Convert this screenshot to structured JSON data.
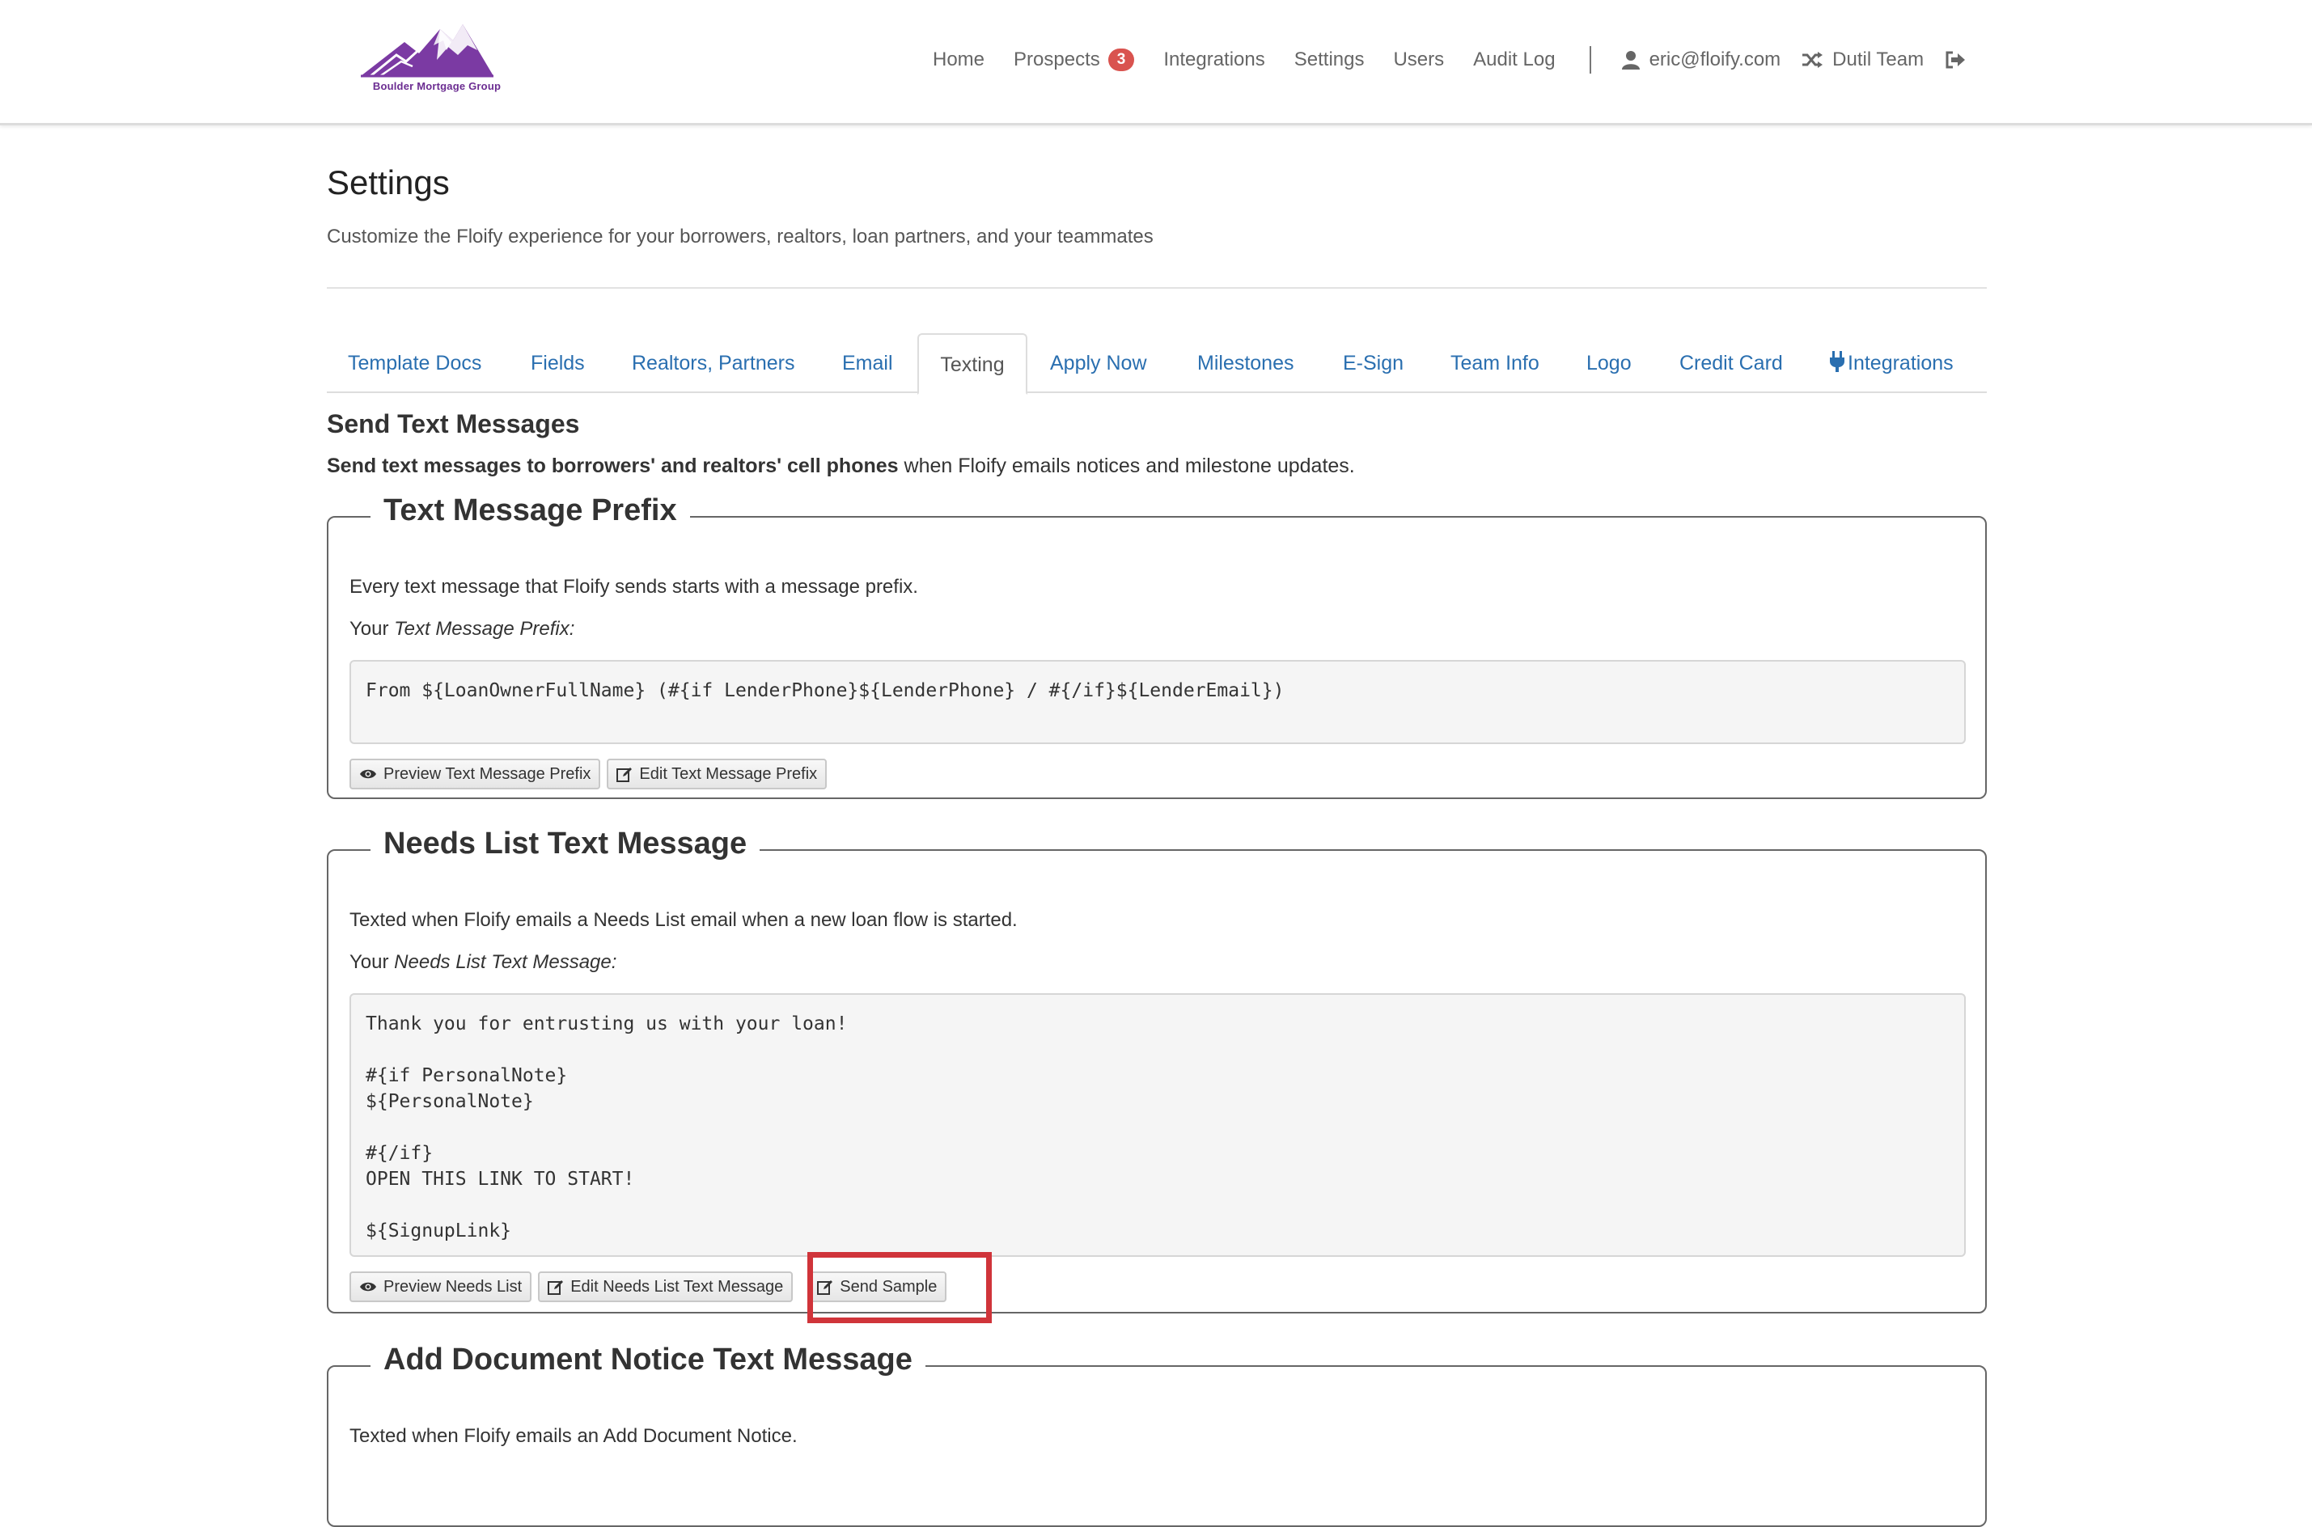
{
  "brand": {
    "logo_text": "Boulder Mortgage Group",
    "color": "#6b2c91"
  },
  "nav": {
    "links": [
      "Home",
      "Prospects",
      "Integrations",
      "Settings",
      "Users",
      "Audit Log"
    ],
    "prospects_badge": "3",
    "user_email": "eric@floify.com",
    "team": "Dutil Team",
    "icons": [
      "user-icon",
      "shuffle-icon",
      "sign-out-icon"
    ]
  },
  "page": {
    "title": "Settings",
    "subtitle": "Customize the Floify experience for your borrowers, realtors, loan partners, and your teammates"
  },
  "tabs": [
    {
      "label": "Template Docs"
    },
    {
      "label": "Fields"
    },
    {
      "label": "Realtors, Partners"
    },
    {
      "label": "Email"
    },
    {
      "label": "Texting",
      "active": true
    },
    {
      "label": "Apply Now"
    },
    {
      "label": "Milestones"
    },
    {
      "label": "E-Sign"
    },
    {
      "label": "Team Info"
    },
    {
      "label": "Logo"
    },
    {
      "label": "Credit Card"
    },
    {
      "label": "Integrations",
      "icon": "plug-icon"
    }
  ],
  "section": {
    "title": "Send Text Messages",
    "desc_bold": "Send text messages to borrowers' and realtors' cell phones",
    "desc_rest": " when Floify emails notices and milestone updates."
  },
  "prefix": {
    "legend": "Text Message Prefix",
    "desc": "Every text message that Floify sends starts with a message prefix.",
    "your_label": "Your ",
    "your_label_em": "Text Message Prefix:",
    "code": "From ${LoanOwnerFullName} (#{if LenderPhone}${LenderPhone} / #{/if}${LenderEmail})",
    "buttons": {
      "preview": "Preview Text Message Prefix",
      "edit": "Edit Text Message Prefix"
    }
  },
  "needs_list": {
    "legend": "Needs List Text Message",
    "desc": "Texted when Floify emails a Needs List email when a new loan flow is started.",
    "your_label": "Your ",
    "your_label_em": "Needs List Text Message:",
    "code": "Thank you for entrusting us with your loan!\n\n#{if PersonalNote}\n${PersonalNote}\n\n#{/if}\nOPEN THIS LINK TO START!\n\n${SignupLink}",
    "buttons": {
      "preview": "Preview Needs List",
      "edit": "Edit Needs List Text Message",
      "send": "Send Sample"
    }
  },
  "add_doc": {
    "legend": "Add Document Notice Text Message",
    "desc": "Texted when Floify emails an Add Document Notice."
  },
  "highlight_color": "#d0343a"
}
